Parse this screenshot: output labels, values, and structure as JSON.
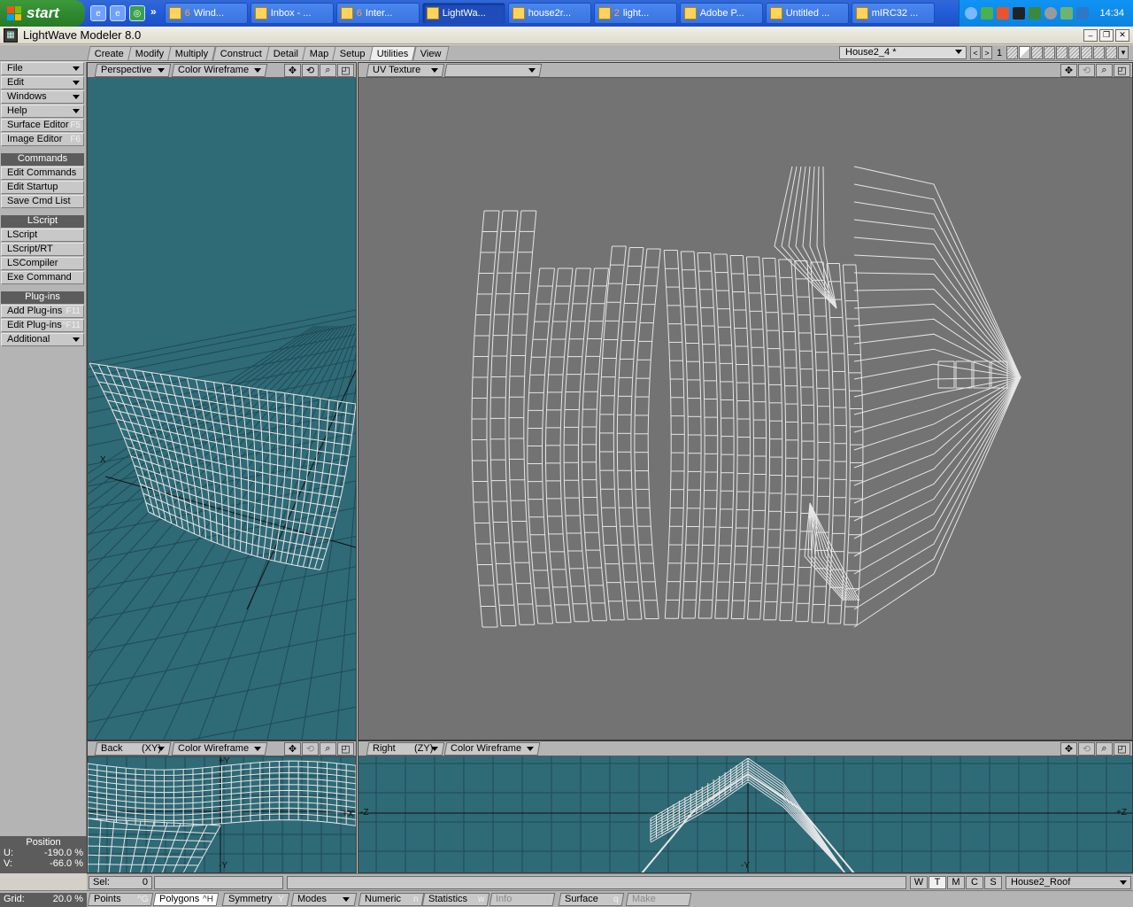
{
  "taskbar": {
    "start_label": "start",
    "quick_launch": [
      "ie-icon",
      "ie-icon",
      "media-icon"
    ],
    "more_label": "»",
    "tasks": [
      {
        "count": "6",
        "label": "Wind...",
        "icon": "folder-icon",
        "active": false
      },
      {
        "count": "",
        "label": "Inbox - ...",
        "icon": "mail-icon",
        "active": false
      },
      {
        "count": "6",
        "label": "Inter...",
        "icon": "ie-icon",
        "active": false
      },
      {
        "count": "",
        "label": "LightWa...",
        "icon": "lightwave-icon",
        "active": true
      },
      {
        "count": "",
        "label": "house2r...",
        "icon": "image-icon",
        "active": false
      },
      {
        "count": "2",
        "label": "light...",
        "icon": "lightwave-icon",
        "active": false
      },
      {
        "count": "",
        "label": "Adobe P...",
        "icon": "photoshop-icon",
        "active": false
      },
      {
        "count": "",
        "label": "Untitled ...",
        "icon": "document-icon",
        "active": false
      },
      {
        "count": "",
        "label": "mIRC32 ...",
        "icon": "mirc-icon",
        "active": false
      }
    ],
    "clock": "14:34"
  },
  "window": {
    "title": "LightWave Modeler 8.0",
    "buttons": [
      "–",
      "❐",
      "✕"
    ]
  },
  "tabs": [
    {
      "label": "Create",
      "active": false
    },
    {
      "label": "Modify",
      "active": false
    },
    {
      "label": "Multiply",
      "active": false
    },
    {
      "label": "Construct",
      "active": false
    },
    {
      "label": "Detail",
      "active": false
    },
    {
      "label": "Map",
      "active": false
    },
    {
      "label": "Setup",
      "active": false
    },
    {
      "label": "Utilities",
      "active": true
    },
    {
      "label": "View",
      "active": false
    }
  ],
  "object_selector": "House2_4 *",
  "layer_nav": {
    "prev": "<",
    "next": ">",
    "current": "1"
  },
  "sidebar": {
    "top": [
      {
        "label": "File",
        "dropdown": true
      },
      {
        "label": "Edit",
        "dropdown": true
      },
      {
        "label": "Windows",
        "dropdown": true
      },
      {
        "label": "Help",
        "dropdown": true
      },
      {
        "label": "Surface Editor",
        "shortcut": "F5"
      },
      {
        "label": "Image Editor",
        "shortcut": "F6"
      }
    ],
    "groups": [
      {
        "title": "Commands",
        "items": [
          {
            "label": "Edit Commands"
          },
          {
            "label": "Edit Startup"
          },
          {
            "label": "Save Cmd List"
          }
        ]
      },
      {
        "title": "LScript",
        "items": [
          {
            "label": "LScript"
          },
          {
            "label": "LScript/RT"
          },
          {
            "label": "LSCompiler"
          },
          {
            "label": "Exe Command"
          }
        ]
      },
      {
        "title": "Plug-ins",
        "items": [
          {
            "label": "Add Plug-ins",
            "shortcut": "F11"
          },
          {
            "label": "Edit Plug-ins",
            "shortcut": "^F11"
          },
          {
            "label": "Additional",
            "dropdown": true
          }
        ]
      }
    ]
  },
  "viewports": {
    "perspective": {
      "view": "Perspective",
      "mode": "Color Wireframe",
      "axis_label": "X"
    },
    "uv": {
      "view": "UV Texture",
      "map": ""
    },
    "back": {
      "view": "Back",
      "axis": "(XY)",
      "mode": "Color Wireframe",
      "labels": [
        "+Y",
        "-Y",
        "+X"
      ]
    },
    "right": {
      "view": "Right",
      "axis": "(ZY)",
      "mode": "Color Wireframe",
      "labels": [
        "-Z",
        "+Z",
        "-Y"
      ]
    }
  },
  "position": {
    "title": "Position",
    "u_label": "U:",
    "u_value": "-190.0 %",
    "v_label": "V:",
    "v_value": "-66.0 %"
  },
  "status": {
    "sel_label": "Sel:",
    "sel_value": "0",
    "vmap_buttons": [
      {
        "label": "W",
        "on": false
      },
      {
        "label": "T",
        "on": true
      },
      {
        "label": "M",
        "on": false
      },
      {
        "label": "C",
        "on": false
      },
      {
        "label": "S",
        "on": false
      }
    ],
    "surface": "House2_Roof"
  },
  "bottom": {
    "grid_label": "Grid:",
    "grid_value": "20.0 %",
    "points": {
      "label": "Points",
      "shortcut": "^G"
    },
    "polygons": {
      "label": "Polygons",
      "shortcut": "^H"
    },
    "symmetry": {
      "label": "Symmetry",
      "shortcut": "Y"
    },
    "modes": {
      "label": "Modes"
    },
    "numeric": {
      "label": "Numeric",
      "shortcut": "n"
    },
    "statistics": {
      "label": "Statistics",
      "shortcut": "w"
    },
    "info": {
      "label": "Info"
    },
    "surface": {
      "label": "Surface",
      "shortcut": "q"
    },
    "make": {
      "label": "Make"
    }
  },
  "colors": {
    "viewport_teal": "#2f6a77",
    "uv_bg": "#737373",
    "wire": "#e6e6e6"
  }
}
